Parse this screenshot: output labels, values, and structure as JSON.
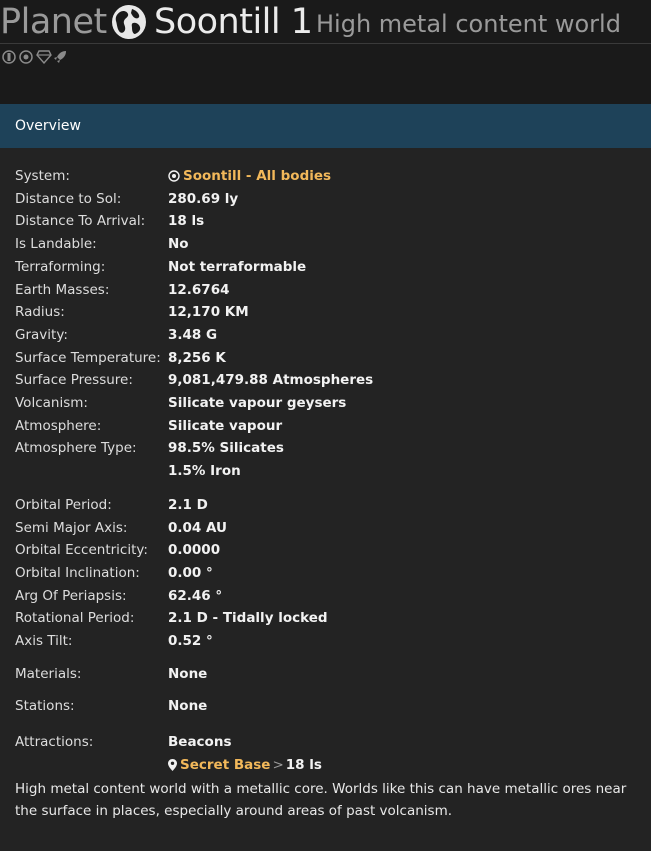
{
  "header": {
    "type_label": "Planet",
    "name": "Soontill 1",
    "subtitle": "High metal content world",
    "icons": [
      "terraform-icon",
      "target-icon",
      "diamond-icon",
      "rocket-icon"
    ]
  },
  "panel": {
    "title": "Overview"
  },
  "rows": {
    "system": {
      "label": "System:",
      "link": "Soontill",
      "sep": " - ",
      "link2": "All bodies"
    },
    "distance_sol": {
      "label": "Distance to Sol:",
      "value": "280.69 ly"
    },
    "distance_arrival": {
      "label": "Distance To Arrival:",
      "value": "18 ls"
    },
    "landable": {
      "label": "Is Landable:",
      "value": "No"
    },
    "terraforming": {
      "label": "Terraforming:",
      "value": "Not terraformable"
    },
    "earth_masses": {
      "label": "Earth Masses:",
      "value": "12.6764"
    },
    "radius": {
      "label": "Radius:",
      "value": "12,170 KM"
    },
    "gravity": {
      "label": "Gravity:",
      "value": "3.48 G"
    },
    "surface_temp": {
      "label": "Surface Temperature:",
      "value": "8,256 K"
    },
    "surface_pressure": {
      "label": "Surface Pressure:",
      "value": "9,081,479.88 Atmospheres"
    },
    "volcanism": {
      "label": "Volcanism:",
      "value": "Silicate vapour geysers"
    },
    "atmosphere": {
      "label": "Atmosphere:",
      "value": "Silicate vapour"
    },
    "atmosphere_type": {
      "label": "Atmosphere Type:",
      "values": [
        "98.5% Silicates",
        "1.5% Iron"
      ]
    },
    "orbital_period": {
      "label": "Orbital Period:",
      "value": "2.1 D"
    },
    "semi_major": {
      "label": "Semi Major Axis:",
      "value": "0.04 AU"
    },
    "eccentricity": {
      "label": "Orbital Eccentricity:",
      "value": "0.0000"
    },
    "inclination": {
      "label": "Orbital Inclination:",
      "value": "0.00 °"
    },
    "periapsis": {
      "label": "Arg Of Periapsis:",
      "value": "62.46 °"
    },
    "rotational": {
      "label": "Rotational Period:",
      "value": "2.1 D - Tidally locked"
    },
    "axis_tilt": {
      "label": "Axis Tilt:",
      "value": "0.52 °"
    },
    "materials": {
      "label": "Materials:",
      "value": "None"
    },
    "stations": {
      "label": "Stations:",
      "value": "None"
    },
    "attractions": {
      "label": "Attractions:",
      "value": "Beacons",
      "link": "Secret Base",
      "arrow": ">",
      "distance": "18 ls"
    }
  },
  "description": "High metal content world with a metallic core. Worlds like this can have metallic ores near the surface in places, especially around areas of past volcanism.",
  "colors": {
    "accent_link": "#f2b85a",
    "panel_header": "#1e4259",
    "background": "#1c1c1d"
  }
}
